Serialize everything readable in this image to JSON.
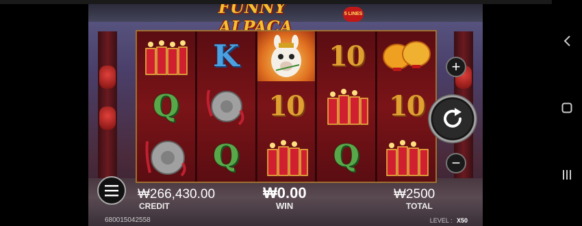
{
  "game": {
    "title": "FUNNY ALPACA",
    "lines_badge": "5 LINES",
    "reels": [
      [
        {
          "symbol": "firecrackers-icon",
          "label": ""
        },
        {
          "symbol": "letter-q",
          "label": "Q"
        },
        {
          "symbol": "gong-icon",
          "label": ""
        }
      ],
      [
        {
          "symbol": "letter-k",
          "label": "K"
        },
        {
          "symbol": "gong-icon",
          "label": ""
        },
        {
          "symbol": "letter-q",
          "label": "Q"
        }
      ],
      [
        {
          "symbol": "alpaca-wild-icon",
          "label": ""
        },
        {
          "symbol": "ten",
          "label": "10"
        },
        {
          "symbol": "firecrackers-icon",
          "label": ""
        }
      ],
      [
        {
          "symbol": "ten",
          "label": "10"
        },
        {
          "symbol": "firecrackers-icon",
          "label": ""
        },
        {
          "symbol": "letter-q",
          "label": "Q"
        }
      ],
      [
        {
          "symbol": "lanterns-icon",
          "label": ""
        },
        {
          "symbol": "ten",
          "label": "10"
        },
        {
          "symbol": "firecrackers-icon",
          "label": ""
        }
      ]
    ],
    "credit": {
      "value": "₩266,430.00",
      "label": "CREDIT"
    },
    "win": {
      "value": "₩0.00",
      "label": "WIN"
    },
    "total": {
      "value": "₩2500",
      "label": "TOTAL"
    },
    "account_id": "680015042558",
    "level": {
      "label": "LEVEL :",
      "value": "X50"
    },
    "controls": {
      "plus": "+",
      "minus": "−",
      "menu": "menu-icon",
      "spin": "spin-icon"
    }
  },
  "nav": {
    "back": "back-icon",
    "home": "home-icon",
    "recents": "recents-icon"
  },
  "colors": {
    "reel_bg": "#7a1418",
    "gold": "#e0a030",
    "frame": "#a07030"
  }
}
